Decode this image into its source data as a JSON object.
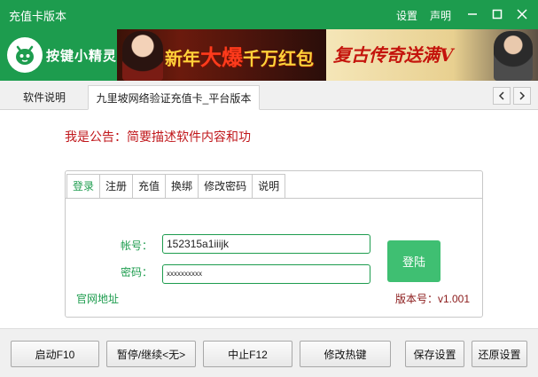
{
  "window": {
    "title": "充值卡版本",
    "menu_settings": "设置",
    "menu_statement": "声明",
    "minimize_icon": "minimize-icon",
    "maximize_icon": "maximize-icon",
    "close_icon": "close-icon"
  },
  "header": {
    "logo_text": "按键小精灵",
    "banner_left_text_a": "新年",
    "banner_left_text_big": "大爆",
    "banner_left_text_b": "千万红包",
    "banner_right_text": "复古传奇送满V"
  },
  "tabs": [
    {
      "label": "软件说明"
    },
    {
      "label": "九里坡网络验证充值卡_平台版本"
    }
  ],
  "content": {
    "announcement": "我是公告：简要描述软件内容和功"
  },
  "panel": {
    "tabs": [
      "登录",
      "注册",
      "充值",
      "换绑",
      "修改密码",
      "说明"
    ],
    "active_tab": 0,
    "account_label": "帐号：",
    "account_value": "152315a1iiijk",
    "password_label": "密码：",
    "password_value": "xxxxxxxxxx",
    "login_button": "登陆",
    "site_link": "官网地址",
    "version": "版本号：v1.001"
  },
  "bottom_buttons": [
    {
      "label": "启动F10"
    },
    {
      "label": "暂停/继续<无>"
    },
    {
      "label": "中止F12"
    },
    {
      "label": "修改热键"
    },
    {
      "label": "保存设置"
    },
    {
      "label": "还原设置"
    }
  ],
  "colors": {
    "brand_green": "#1d9c4e",
    "login_green": "#3fbf72",
    "announcement_red": "#c0171b",
    "version_red": "#8b1a1a"
  }
}
